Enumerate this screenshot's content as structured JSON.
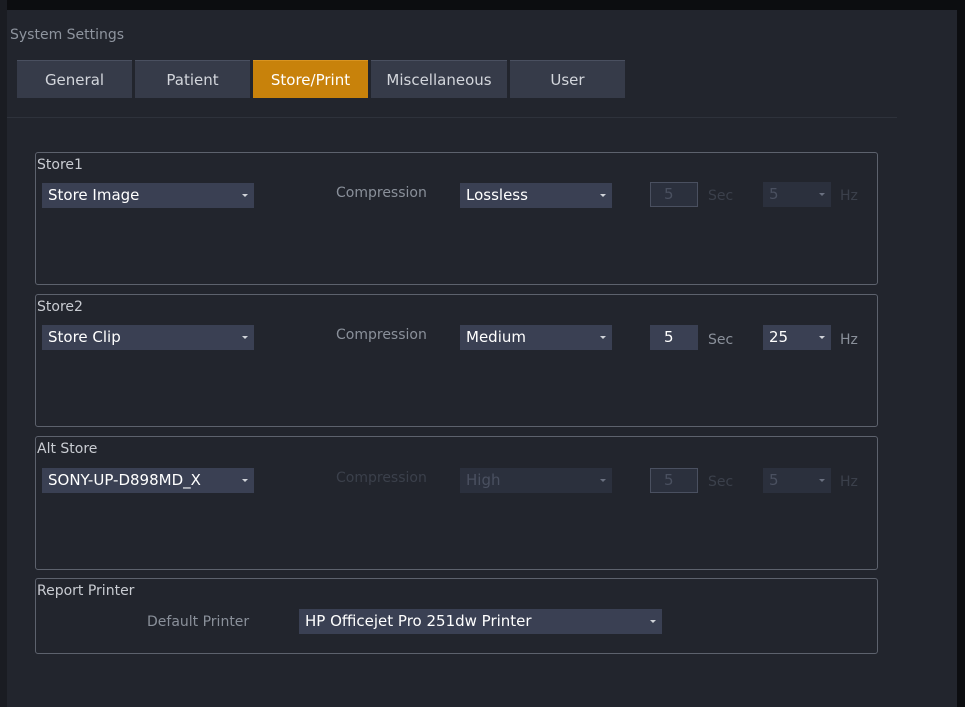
{
  "window": {
    "title": "System Settings"
  },
  "tabs": [
    {
      "label": "General"
    },
    {
      "label": "Patient"
    },
    {
      "label": "Store/Print"
    },
    {
      "label": "Miscellaneous"
    },
    {
      "label": "User"
    }
  ],
  "store1": {
    "title": "Store1",
    "action": "Store Image",
    "compression_label": "Compression",
    "compression": "Lossless",
    "seconds": "5",
    "sec_unit": "Sec",
    "rate": "5",
    "hz_unit": "Hz"
  },
  "store2": {
    "title": "Store2",
    "action": "Store Clip",
    "compression_label": "Compression",
    "compression": "Medium",
    "seconds": "5",
    "sec_unit": "Sec",
    "rate": "25",
    "hz_unit": "Hz"
  },
  "alt_store": {
    "title": "Alt Store",
    "action": "SONY-UP-D898MD_X",
    "compression_label": "Compression",
    "compression": "High",
    "seconds": "5",
    "sec_unit": "Sec",
    "rate": "5",
    "hz_unit": "Hz"
  },
  "report_printer": {
    "title": "Report Printer",
    "default_label": "Default Printer",
    "printer": "HP Officejet Pro 251dw Printer"
  },
  "colors": {
    "background": "#22252d",
    "tab": "#363b49",
    "tab_active": "#c8820b",
    "field": "#3a4053",
    "border": "#5d626d"
  }
}
